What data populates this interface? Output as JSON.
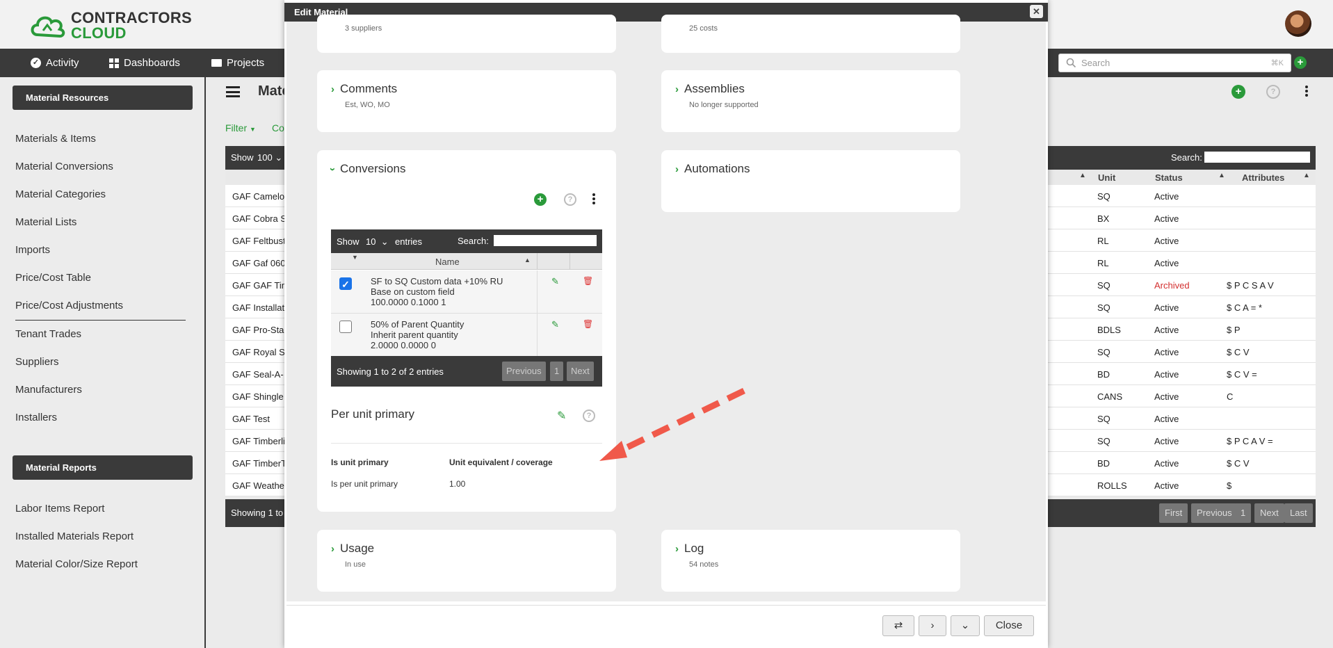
{
  "app": {
    "logo_line1": "CONTRACTORS",
    "logo_line2": "CLOUD"
  },
  "nav": {
    "items": [
      {
        "label": "Activity",
        "icon": "check-circle-icon"
      },
      {
        "label": "Dashboards",
        "icon": "grid-icon"
      },
      {
        "label": "Projects",
        "icon": "folder-icon"
      }
    ]
  },
  "global_search": {
    "placeholder": "Search",
    "shortcut": "⌘K"
  },
  "sidebar": {
    "resources_header": "Material Resources",
    "resources": [
      "Materials & Items",
      "Material Conversions",
      "Material Categories",
      "Material Lists",
      "Imports",
      "Price/Cost Table",
      "Price/Cost Adjustments",
      "Tenant Trades",
      "Suppliers",
      "Manufacturers",
      "Installers"
    ],
    "reports_header": "Material Reports",
    "reports": [
      "Labor Items Report",
      "Installed Materials Report",
      "Material Color/Size Report"
    ]
  },
  "main": {
    "title": "Mate",
    "filter_label": "Filter",
    "columns_label": "Co",
    "show_label": "Show",
    "show_value": "100",
    "search_label": "Search:",
    "columns": [
      "Unit",
      "Status",
      "Attributes"
    ],
    "rows": [
      {
        "name": "GAF Camelot",
        "unit": "SQ",
        "status": "Active",
        "attrs": ""
      },
      {
        "name": "GAF Cobra S",
        "unit": "BX",
        "status": "Active",
        "attrs": ""
      },
      {
        "name": "GAF Feltbust",
        "unit": "RL",
        "status": "Active",
        "attrs": ""
      },
      {
        "name": "GAF Gaf 060",
        "unit": "RL",
        "status": "Active",
        "attrs": ""
      },
      {
        "name": "GAF GAF Tim",
        "unit": "SQ",
        "status": "Archived",
        "attrs": "$ P C S A V"
      },
      {
        "name": "GAF Installat",
        "unit": "SQ",
        "status": "Active",
        "attrs": "$ C A = *"
      },
      {
        "name": "GAF Pro-Star",
        "unit": "BDLS",
        "status": "Active",
        "attrs": "$ P"
      },
      {
        "name": "GAF Royal Sc",
        "unit": "SQ",
        "status": "Active",
        "attrs": "$ C V"
      },
      {
        "name": "GAF Seal-A-",
        "unit": "BD",
        "status": "Active",
        "attrs": "$ C V ="
      },
      {
        "name": "GAF Shingle",
        "unit": "CANS",
        "status": "Active",
        "attrs": "C"
      },
      {
        "name": "GAF Test",
        "unit": "SQ",
        "status": "Active",
        "attrs": ""
      },
      {
        "name": "GAF Timberli",
        "unit": "SQ",
        "status": "Active",
        "attrs": "$ P C A V ="
      },
      {
        "name": "GAF TimberT",
        "unit": "BD",
        "status": "Active",
        "attrs": "$ C V"
      },
      {
        "name": "GAF Weather",
        "unit": "ROLLS",
        "status": "Active",
        "attrs": "$"
      }
    ],
    "footer_text": "Showing 1 to",
    "pager": [
      "First",
      "Previous",
      "1",
      "Next",
      "Last"
    ]
  },
  "colors": {
    "brand_green": "#2a9a3a",
    "dark_bar": "#3a3a3a",
    "archived_red": "#d32f2f"
  },
  "modal": {
    "title": "Edit Material",
    "suppliers_sub": "3 suppliers",
    "costs_sub": "25 costs",
    "comments": {
      "title": "Comments",
      "sub": "Est, WO, MO"
    },
    "assemblies": {
      "title": "Assemblies",
      "sub": "No longer supported"
    },
    "automations": {
      "title": "Automations"
    },
    "conversions": {
      "title": "Conversions",
      "show_label": "Show",
      "show_value": "10",
      "entries_label": "entries",
      "search_label": "Search:",
      "name_col": "Name",
      "rows": [
        {
          "checked": true,
          "line1": "SF to SQ Custom data +10% RU",
          "line2": "Base on custom field",
          "line3": "100.0000 0.1000 1"
        },
        {
          "checked": false,
          "line1": "50% of Parent Quantity",
          "line2": "Inherit parent quantity",
          "line3": "2.0000 0.0000 0"
        }
      ],
      "footer_text": "Showing 1 to 2 of 2 entries",
      "pager": [
        "Previous",
        "1",
        "Next"
      ],
      "per_unit_title": "Per unit primary",
      "table_headers": [
        "Is unit primary",
        "Unit equivalent / coverage"
      ],
      "table_values": [
        "Is per unit primary",
        "1.00"
      ]
    },
    "usage": {
      "title": "Usage",
      "sub": "In use"
    },
    "log": {
      "title": "Log",
      "sub": "54 notes"
    },
    "close_label": "Close"
  }
}
